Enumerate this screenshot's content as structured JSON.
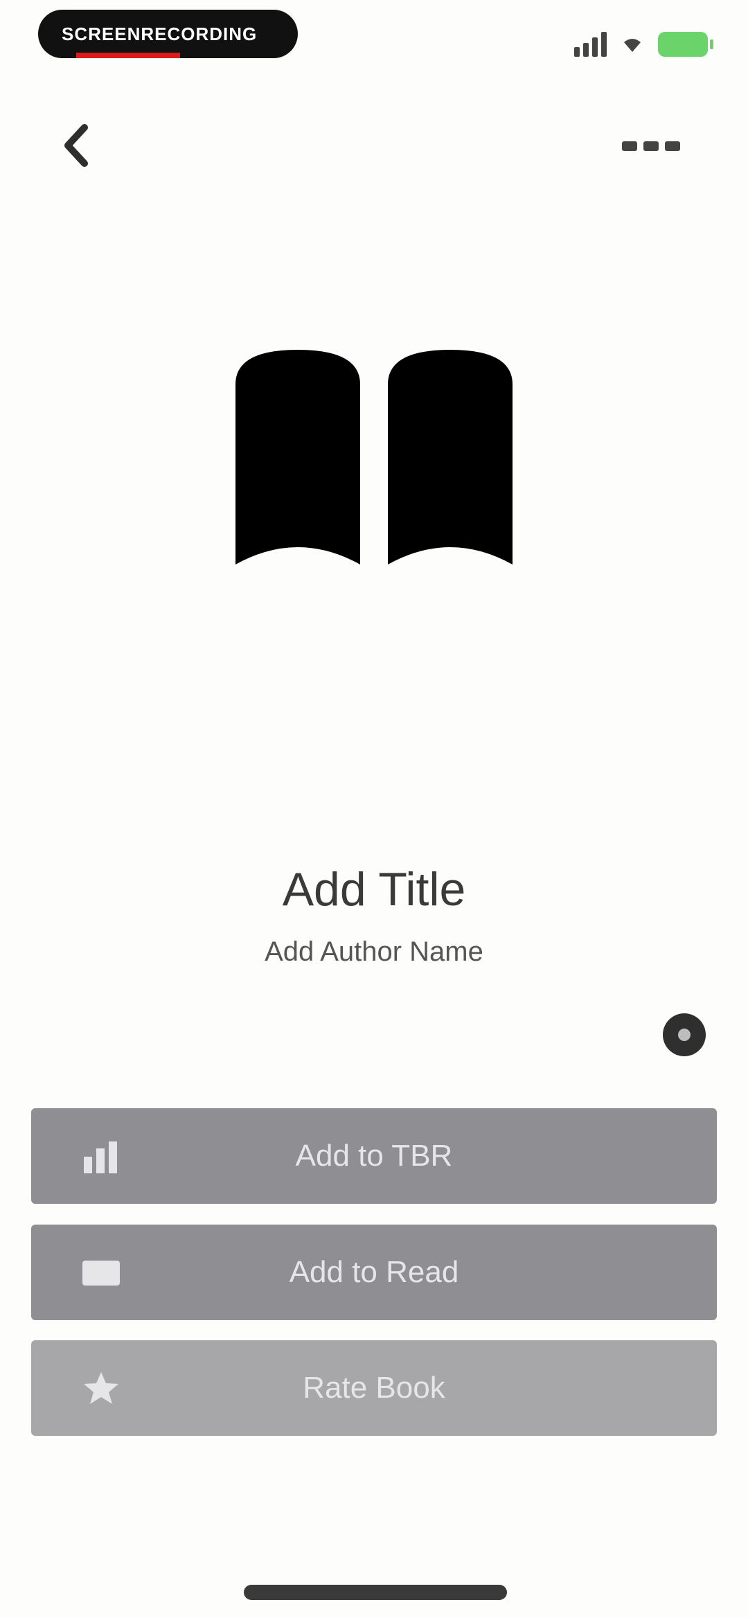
{
  "status_bar": {
    "pill_text": "SCREENRECORDING"
  },
  "book": {
    "title": "Add Title",
    "author": "Add Author Name"
  },
  "actions": [
    {
      "label": "Add to TBR",
      "icon": "tbr-icon"
    },
    {
      "label": "Add to Read",
      "icon": "read-icon"
    },
    {
      "label": "Rate Book",
      "icon": "star-icon"
    }
  ],
  "colors": {
    "background": "#fdfdfb",
    "button": "#8f8f93",
    "button_light": "#a7a7aa",
    "battery": "#6ad36a",
    "recording_red": "#d91c1c"
  }
}
